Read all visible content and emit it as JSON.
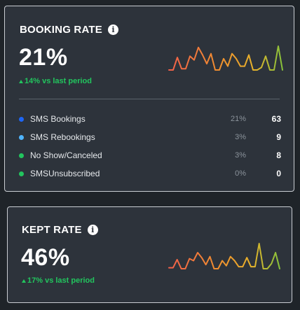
{
  "booking_rate": {
    "title": "BOOKING RATE",
    "info_icon": "info-icon",
    "value": "21%",
    "delta": "14% vs last period",
    "delta_color": "#22c55e",
    "sparkline": [
      2,
      2,
      12,
      3,
      3,
      13,
      10,
      20,
      14,
      7,
      15,
      2,
      2,
      11,
      5,
      15,
      11,
      5,
      5,
      14,
      2,
      2,
      4,
      13,
      2,
      2,
      21,
      2
    ],
    "legend": [
      {
        "label": "SMS Bookings",
        "percent": "21%",
        "count": "63",
        "color": "#1e66f5"
      },
      {
        "label": "SMS Rebookings",
        "percent": "3%",
        "count": "9",
        "color": "#4fb4ff"
      },
      {
        "label": "No Show/Canceled",
        "percent": "3%",
        "count": "8",
        "color": "#22c55e"
      },
      {
        "label": "SMSUnsubscribed",
        "percent": "0%",
        "count": "0",
        "color": "#22c55e"
      }
    ]
  },
  "kept_rate": {
    "title": "KEPT RATE",
    "info_icon": "info-icon",
    "value": "46%",
    "delta": "17% vs last period",
    "delta_color": "#22c55e",
    "sparkline": [
      3,
      3,
      11,
      2,
      2,
      12,
      10,
      18,
      13,
      6,
      14,
      2,
      2,
      10,
      5,
      14,
      10,
      4,
      4,
      13,
      4,
      4,
      27,
      2,
      2,
      7,
      18,
      2
    ]
  }
}
